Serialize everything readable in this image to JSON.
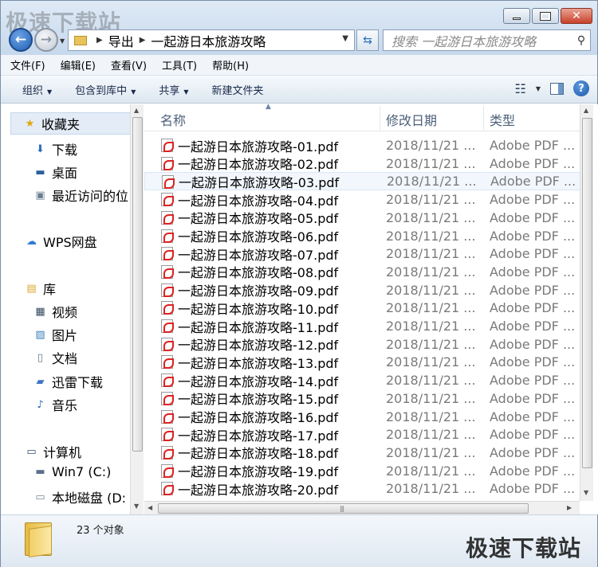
{
  "watermark": "极速下载站",
  "address": {
    "crumb1": "导出",
    "crumb2": "一起游日本旅游攻略"
  },
  "search": {
    "placeholder": "搜索 一起游日本旅游攻略"
  },
  "menu": [
    "文件(F)",
    "编辑(E)",
    "查看(V)",
    "工具(T)",
    "帮助(H)"
  ],
  "commands": {
    "organize": "组织",
    "include": "包含到库中",
    "share": "共享",
    "new_folder": "新建文件夹"
  },
  "nav": {
    "favorites": "收藏夹",
    "downloads": "下载",
    "desktop": "桌面",
    "recent": "最近访问的位",
    "wps": "WPS网盘",
    "libraries": "库",
    "video": "视频",
    "pictures": "图片",
    "documents": "文档",
    "thunder": "迅雷下载",
    "music": "音乐",
    "computer": "计算机",
    "win7": "Win7 (C:)",
    "local": "本地磁盘 (D:"
  },
  "columns": {
    "name": "名称",
    "date": "修改日期",
    "type": "类型"
  },
  "files": [
    {
      "name": "一起游日本旅游攻略-01.pdf",
      "date": "2018/11/21 ...",
      "type": "Adobe PDF ..."
    },
    {
      "name": "一起游日本旅游攻略-02.pdf",
      "date": "2018/11/21 ...",
      "type": "Adobe PDF ..."
    },
    {
      "name": "一起游日本旅游攻略-03.pdf",
      "date": "2018/11/21 ...",
      "type": "Adobe PDF ..."
    },
    {
      "name": "一起游日本旅游攻略-04.pdf",
      "date": "2018/11/21 ...",
      "type": "Adobe PDF ..."
    },
    {
      "name": "一起游日本旅游攻略-05.pdf",
      "date": "2018/11/21 ...",
      "type": "Adobe PDF ..."
    },
    {
      "name": "一起游日本旅游攻略-06.pdf",
      "date": "2018/11/21 ...",
      "type": "Adobe PDF ..."
    },
    {
      "name": "一起游日本旅游攻略-07.pdf",
      "date": "2018/11/21 ...",
      "type": "Adobe PDF ..."
    },
    {
      "name": "一起游日本旅游攻略-08.pdf",
      "date": "2018/11/21 ...",
      "type": "Adobe PDF ..."
    },
    {
      "name": "一起游日本旅游攻略-09.pdf",
      "date": "2018/11/21 ...",
      "type": "Adobe PDF ..."
    },
    {
      "name": "一起游日本旅游攻略-10.pdf",
      "date": "2018/11/21 ...",
      "type": "Adobe PDF ..."
    },
    {
      "name": "一起游日本旅游攻略-11.pdf",
      "date": "2018/11/21 ...",
      "type": "Adobe PDF ..."
    },
    {
      "name": "一起游日本旅游攻略-12.pdf",
      "date": "2018/11/21 ...",
      "type": "Adobe PDF ..."
    },
    {
      "name": "一起游日本旅游攻略-13.pdf",
      "date": "2018/11/21 ...",
      "type": "Adobe PDF ..."
    },
    {
      "name": "一起游日本旅游攻略-14.pdf",
      "date": "2018/11/21 ...",
      "type": "Adobe PDF ..."
    },
    {
      "name": "一起游日本旅游攻略-15.pdf",
      "date": "2018/11/21 ...",
      "type": "Adobe PDF ..."
    },
    {
      "name": "一起游日本旅游攻略-16.pdf",
      "date": "2018/11/21 ...",
      "type": "Adobe PDF ..."
    },
    {
      "name": "一起游日本旅游攻略-17.pdf",
      "date": "2018/11/21 ...",
      "type": "Adobe PDF ..."
    },
    {
      "name": "一起游日本旅游攻略-18.pdf",
      "date": "2018/11/21 ...",
      "type": "Adobe PDF ..."
    },
    {
      "name": "一起游日本旅游攻略-19.pdf",
      "date": "2018/11/21 ...",
      "type": "Adobe PDF ..."
    },
    {
      "name": "一起游日本旅游攻略-20.pdf",
      "date": "2018/11/21 ...",
      "type": "Adobe PDF ..."
    }
  ],
  "status": {
    "count": "23 个对象"
  },
  "colors": {
    "accent": "#1f5fb3",
    "selection": "#f2f7fd",
    "pdf_red": "#dd2222"
  }
}
